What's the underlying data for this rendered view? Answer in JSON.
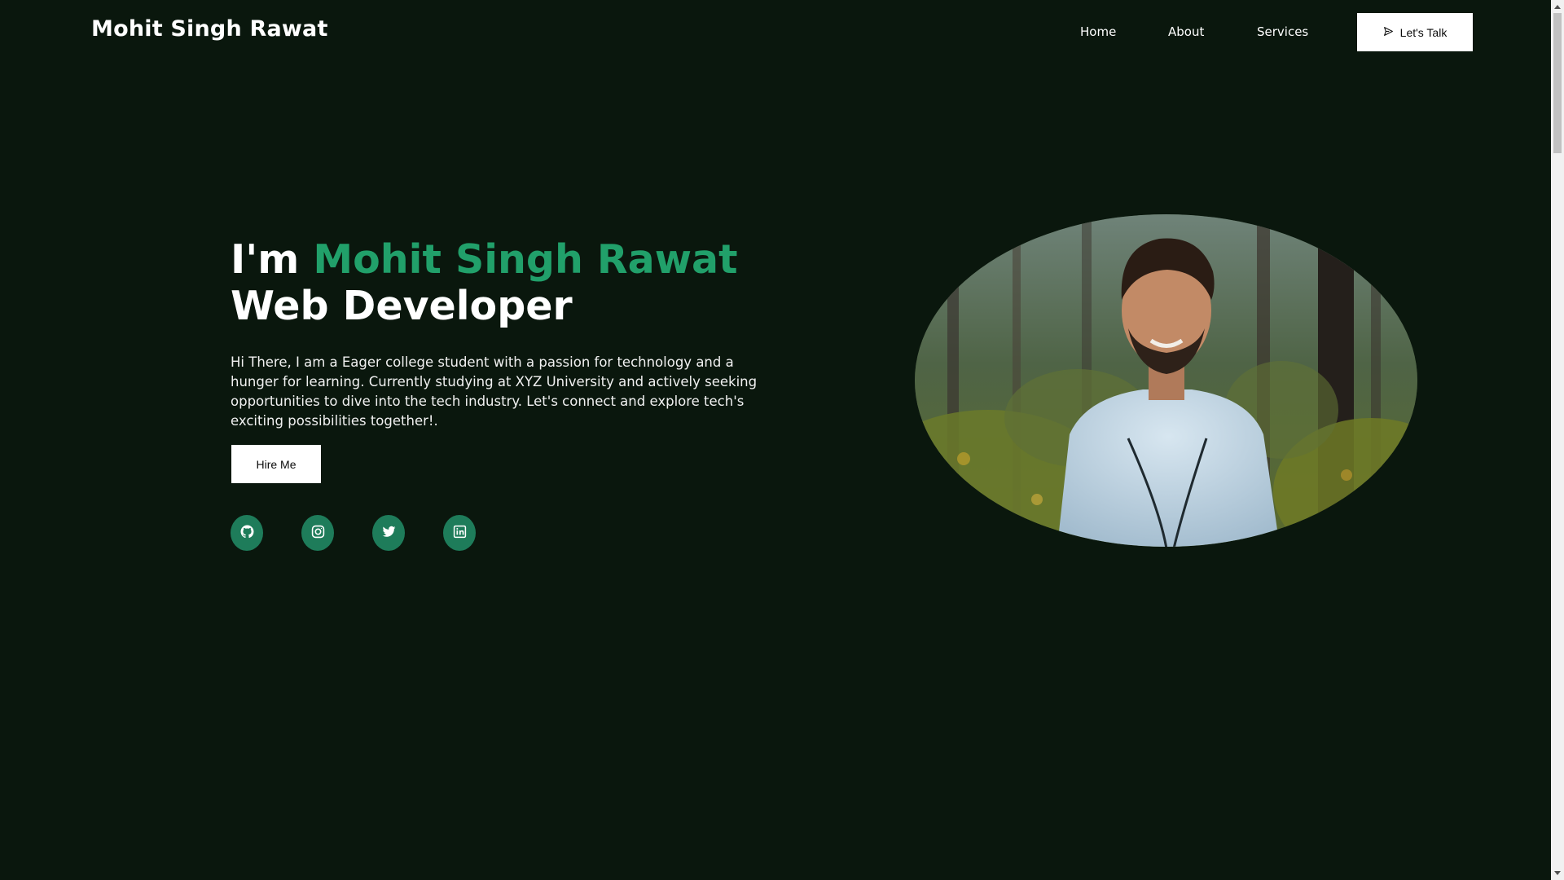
{
  "navbar": {
    "brand": "Mohit Singh Rawat",
    "links": [
      {
        "label": "Home"
      },
      {
        "label": "About"
      },
      {
        "label": "Services"
      }
    ],
    "cta_label": "Let's Talk",
    "cta_icon": "send-icon"
  },
  "hero": {
    "intro": "I'm ",
    "name": "Mohit Singh Rawat",
    "role": "Web Developer",
    "bio": "Hi There, I am a Eager college student with a passion for technology and a hunger for learning. Currently studying at XYZ University and actively seeking opportunities to dive into the tech industry. Let's connect and explore tech's exciting possibilities together!.",
    "hire_label": "Hire Me",
    "accent_color": "#21a06a"
  },
  "socials": [
    {
      "icon": "github-icon"
    },
    {
      "icon": "instagram-icon"
    },
    {
      "icon": "twitter-icon"
    },
    {
      "icon": "linkedin-icon"
    }
  ],
  "colors": {
    "background": "#0a170d",
    "social_bg": "#1e7c5a",
    "button_bg": "#ffffff"
  }
}
